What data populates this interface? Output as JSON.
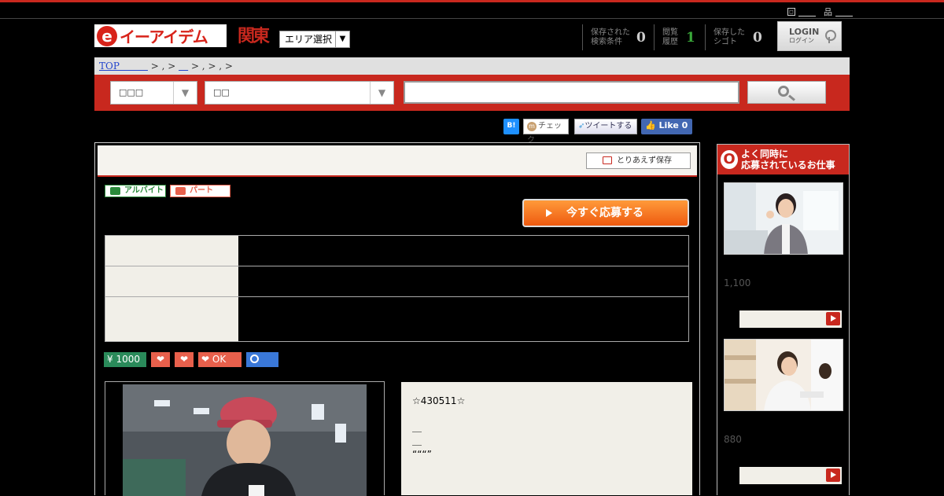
{
  "utility": {
    "link1": "＿＿",
    "link2": "＿＿"
  },
  "header": {
    "logo_text": "イーアイデム",
    "logo_mark": "e",
    "region": "関東",
    "area_select": "エリア選択",
    "stats": [
      {
        "label": "保存された 検索条件",
        "count": "0"
      },
      {
        "label": "閲覧 履歴",
        "count": "1"
      },
      {
        "label": "保存した シゴト",
        "count": "0"
      }
    ],
    "login_label": "LOGIN",
    "login_sub": "ログイン"
  },
  "breadcrumb": {
    "top": "TOP＿＿＿",
    "rest": " > , > ",
    "mid": "＿",
    "tail": " > , > , >"
  },
  "search": {
    "select1": "□□□",
    "select2": "□□",
    "input_value": ""
  },
  "share": {
    "hatena": "B!",
    "mixi": "チェック",
    "tweet": "ツイートする",
    "facebook": "Like 0"
  },
  "job": {
    "save_label": "とりあえず保存",
    "tags": [
      "アルバイト",
      "パート"
    ],
    "apply_label": "今すぐ応募する",
    "badges": {
      "wage": "¥ 1000",
      "ok": "OK"
    },
    "description_lines": [
      "☆430511☆",
      "",
      "＿",
      "＿",
      "“““”"
    ]
  },
  "sidebar": {
    "title_line1": "よく同時に",
    "title_line2": "応募されているお仕事",
    "title_mark": "O",
    "items": [
      {
        "wage": "1,100"
      },
      {
        "wage": "880"
      }
    ]
  },
  "colors": {
    "brand_red": "#c8281e",
    "accent_orange": "#ee5a10",
    "badge_green": "#2a8a5a",
    "badge_blue": "#3a78d8"
  }
}
